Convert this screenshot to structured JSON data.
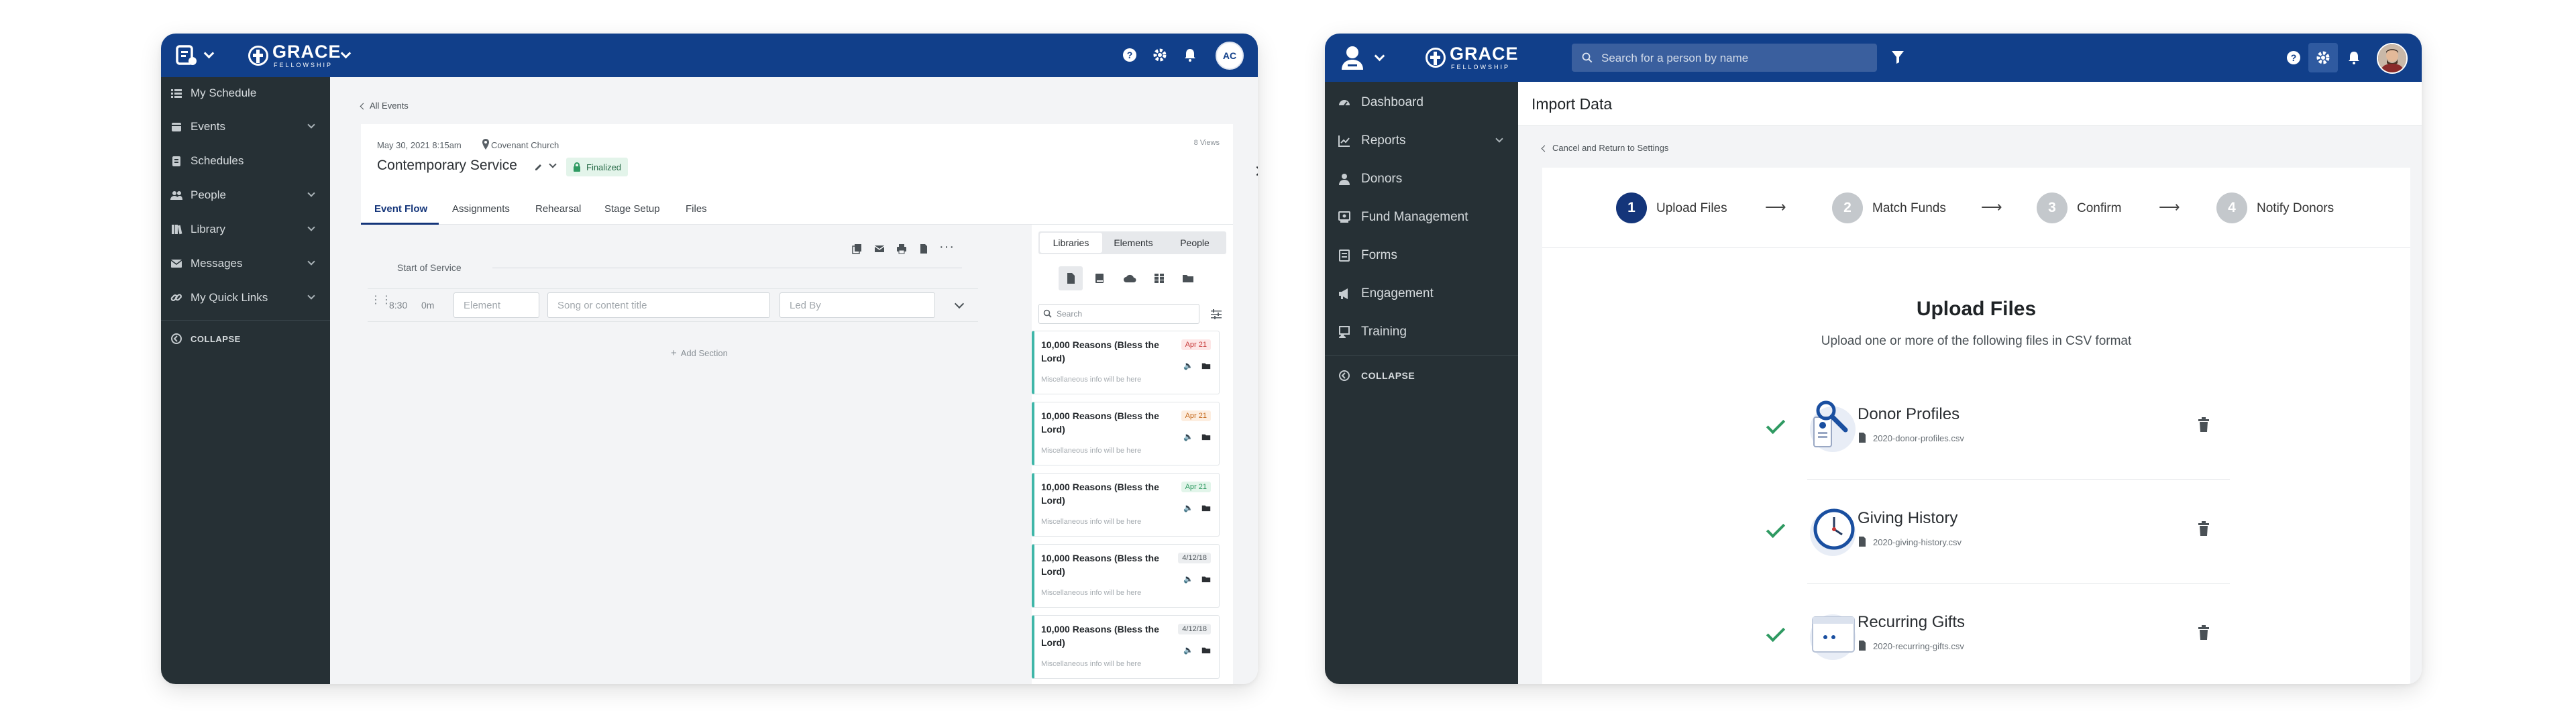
{
  "colors": {
    "topbar": "#113f8a",
    "sidebar": "#263035",
    "accent": "#14357a",
    "success": "#2f9a62",
    "teal": "#3fb6a8"
  },
  "left_window": {
    "logo": {
      "name": "GRACE",
      "sub": "FELLOWSHIP"
    },
    "avatar_initials": "AC",
    "sidebar": {
      "items": [
        {
          "label": "My Schedule",
          "icon": "list-icon"
        },
        {
          "label": "Events",
          "icon": "calendar-icon"
        },
        {
          "label": "Schedules",
          "icon": "clipboard-icon"
        },
        {
          "label": "People",
          "icon": "people-icon"
        },
        {
          "label": "Library",
          "icon": "library-icon"
        },
        {
          "label": "Messages",
          "icon": "envelope-icon"
        },
        {
          "label": "My Quick Links",
          "icon": "link-icon"
        }
      ],
      "collapse_label": "COLLAPSE"
    },
    "back_label": "All Events",
    "event": {
      "datetime": "May 30, 2021 8:15am",
      "location": "Covenant Church",
      "title": "Contemporary Service",
      "status": "Finalized",
      "views": "8 Views"
    },
    "tabs": [
      "Event Flow",
      "Assignments",
      "Rehearsal",
      "Stage Setup",
      "Files"
    ],
    "flow": {
      "section_label": "Start of Service",
      "row": {
        "time": "8:30",
        "duration": "0m",
        "element_placeholder": "Element",
        "song_placeholder": "Song or content title",
        "ledby_placeholder": "Led By"
      },
      "add_section_label": "Add Section"
    },
    "library_panel": {
      "tabs": [
        "Libraries",
        "Elements",
        "People"
      ],
      "search_placeholder": "Search",
      "items": [
        {
          "title": "10,000 Reasons (Bless the Lord)",
          "misc": "Miscellaneous info will be here",
          "date": "Apr 21",
          "badge": "red"
        },
        {
          "title": "10,000 Reasons (Bless the Lord)",
          "misc": "Miscellaneous info will be here",
          "date": "Apr 21",
          "badge": "orange"
        },
        {
          "title": "10,000 Reasons (Bless the Lord)",
          "misc": "Miscellaneous info will be here",
          "date": "Apr 21",
          "badge": "green"
        },
        {
          "title": "10,000 Reasons (Bless the Lord)",
          "misc": "Miscellaneous info will be here",
          "date": "4/12/18",
          "badge": "gray"
        },
        {
          "title": "10,000 Reasons (Bless the Lord)",
          "misc": "Miscellaneous info will be here",
          "date": "4/12/18",
          "badge": "gray"
        }
      ]
    }
  },
  "right_window": {
    "logo": {
      "name": "GRACE",
      "sub": "FELLOWSHIP"
    },
    "search_placeholder": "Search for a person by name",
    "sidebar": {
      "items": [
        {
          "label": "Dashboard",
          "icon": "dashboard-icon"
        },
        {
          "label": "Reports",
          "icon": "chart-icon"
        },
        {
          "label": "Donors",
          "icon": "person-icon"
        },
        {
          "label": "Fund Management",
          "icon": "fund-icon"
        },
        {
          "label": "Forms",
          "icon": "form-icon"
        },
        {
          "label": "Engagement",
          "icon": "megaphone-icon"
        },
        {
          "label": "Training",
          "icon": "training-icon"
        }
      ],
      "collapse_label": "COLLAPSE"
    },
    "page_title": "Import Data",
    "back_label": "Cancel and Return to Settings",
    "steps": [
      {
        "num": "1",
        "label": "Upload Files",
        "active": true
      },
      {
        "num": "2",
        "label": "Match Funds",
        "active": false
      },
      {
        "num": "3",
        "label": "Confirm",
        "active": false
      },
      {
        "num": "4",
        "label": "Notify Donors",
        "active": false
      }
    ],
    "upload": {
      "title": "Upload Files",
      "subtitle": "Upload one or more of the following files in CSV format",
      "files": [
        {
          "name": "Donor Profiles",
          "file": "2020-donor-profiles.csv",
          "icon": "donor-profiles-icon"
        },
        {
          "name": "Giving History",
          "file": "2020-giving-history.csv",
          "icon": "clock-icon"
        },
        {
          "name": "Recurring Gifts",
          "file": "2020-recurring-gifts.csv",
          "icon": "calendar-icon"
        }
      ]
    }
  }
}
